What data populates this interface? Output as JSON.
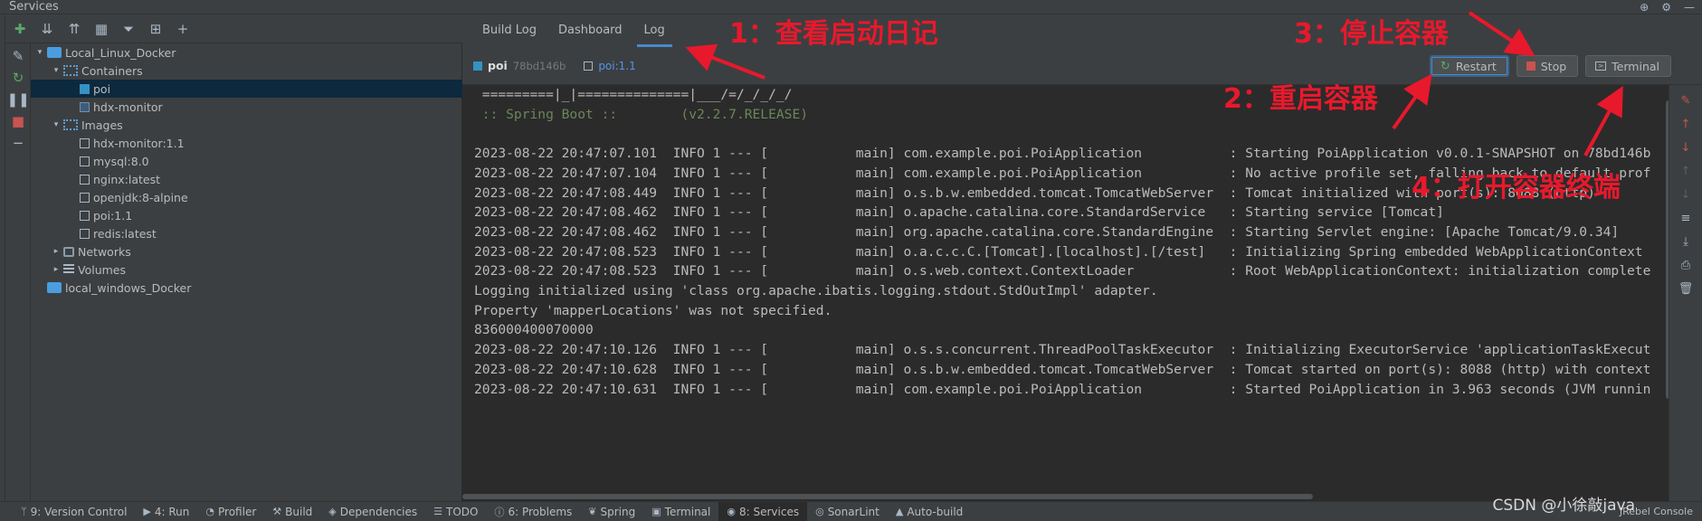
{
  "window": {
    "title": "Services"
  },
  "tree": {
    "items": [
      {
        "label": "Local_Linux_Docker",
        "depth": 0,
        "expanded": true,
        "icon": "docker-icon"
      },
      {
        "label": "Containers",
        "depth": 1,
        "expanded": true,
        "icon": "containers-icon"
      },
      {
        "label": "poi",
        "depth": 2,
        "icon": "container-running-icon",
        "selected": true
      },
      {
        "label": "hdx-monitor",
        "depth": 2,
        "icon": "container-icon"
      },
      {
        "label": "Images",
        "depth": 1,
        "expanded": true,
        "icon": "images-icon"
      },
      {
        "label": "hdx-monitor:1.1",
        "depth": 2,
        "icon": "image-icon"
      },
      {
        "label": "mysql:8.0",
        "depth": 2,
        "icon": "image-icon"
      },
      {
        "label": "nginx:latest",
        "depth": 2,
        "icon": "image-icon"
      },
      {
        "label": "openjdk:8-alpine",
        "depth": 2,
        "icon": "image-icon"
      },
      {
        "label": "poi:1.1",
        "depth": 2,
        "icon": "image-icon"
      },
      {
        "label": "redis:latest",
        "depth": 2,
        "icon": "image-icon"
      },
      {
        "label": "Networks",
        "depth": 1,
        "expanded": false,
        "icon": "networks-icon"
      },
      {
        "label": "Volumes",
        "depth": 1,
        "expanded": false,
        "icon": "volumes-icon"
      },
      {
        "label": "local_windows_Docker",
        "depth": 0,
        "icon": "docker-icon"
      }
    ]
  },
  "tabs": [
    {
      "label": "Build Log"
    },
    {
      "label": "Dashboard"
    },
    {
      "label": "Log",
      "active": true
    }
  ],
  "container": {
    "name": "poi",
    "id": "78bd146b",
    "image": "poi:1.1"
  },
  "actions": {
    "restart": "Restart",
    "stop": "Stop",
    "terminal": "Terminal"
  },
  "log": {
    "lines": [
      " =========|_|==============|___/=/_/_/_/",
      " :: Spring Boot ::        (v2.2.7.RELEASE)",
      "",
      "2023-08-22 20:47:07.101  INFO 1 --- [           main] com.example.poi.PoiApplication           : Starting PoiApplication v0.0.1-SNAPSHOT on 78bd146b",
      "2023-08-22 20:47:07.104  INFO 1 --- [           main] com.example.poi.PoiApplication           : No active profile set, falling back to default prof",
      "2023-08-22 20:47:08.449  INFO 1 --- [           main] o.s.b.w.embedded.tomcat.TomcatWebServer  : Tomcat initialized with port(s): 8088 (http)",
      "2023-08-22 20:47:08.462  INFO 1 --- [           main] o.apache.catalina.core.StandardService   : Starting service [Tomcat]",
      "2023-08-22 20:47:08.462  INFO 1 --- [           main] org.apache.catalina.core.StandardEngine  : Starting Servlet engine: [Apache Tomcat/9.0.34]",
      "2023-08-22 20:47:08.523  INFO 1 --- [           main] o.a.c.c.C.[Tomcat].[localhost].[/test]   : Initializing Spring embedded WebApplicationContext",
      "2023-08-22 20:47:08.523  INFO 1 --- [           main] o.s.web.context.ContextLoader            : Root WebApplicationContext: initialization complete",
      "Logging initialized using 'class org.apache.ibatis.logging.stdout.StdOutImpl' adapter.",
      "Property 'mapperLocations' was not specified.",
      "836000400070000",
      "2023-08-22 20:47:10.126  INFO 1 --- [           main] o.s.s.concurrent.ThreadPoolTaskExecutor  : Initializing ExecutorService 'applicationTaskExecut",
      "2023-08-22 20:47:10.628  INFO 1 --- [           main] o.s.b.w.embedded.tomcat.TomcatWebServer  : Tomcat started on port(s): 8088 (http) with context",
      "2023-08-22 20:47:10.631  INFO 1 --- [           main] com.example.poi.PoiApplication           : Started PoiApplication in 3.963 seconds (JVM runnin"
    ]
  },
  "statusbar": [
    {
      "label": "9: Version Control",
      "icon": "branch-icon"
    },
    {
      "label": "4: Run",
      "icon": "run-icon"
    },
    {
      "label": "Profiler",
      "icon": "profiler-icon"
    },
    {
      "label": "Build",
      "icon": "hammer-icon"
    },
    {
      "label": "Dependencies",
      "icon": "dependencies-icon"
    },
    {
      "label": "TODO",
      "icon": "list-icon"
    },
    {
      "label": "6: Problems",
      "icon": "info-icon"
    },
    {
      "label": "Spring",
      "icon": "spring-icon"
    },
    {
      "label": "Terminal",
      "icon": "terminal-icon"
    },
    {
      "label": "8: Services",
      "icon": "services-icon",
      "active": true
    },
    {
      "label": "SonarLint",
      "icon": "sonarlint-icon"
    },
    {
      "label": "Auto-build",
      "icon": "warning-icon"
    }
  ],
  "jrebel": "JRebel Console",
  "annotations": {
    "a1": "1：查看启动日记",
    "a2": "2：重启容器",
    "a3": "3：停止容器",
    "a4": "4：打开容器终端"
  },
  "watermark": "CSDN @小徐敲java",
  "colors": {
    "accent": "#4a88c7",
    "annotation": "#e8192c",
    "spring": "#6a8759"
  }
}
